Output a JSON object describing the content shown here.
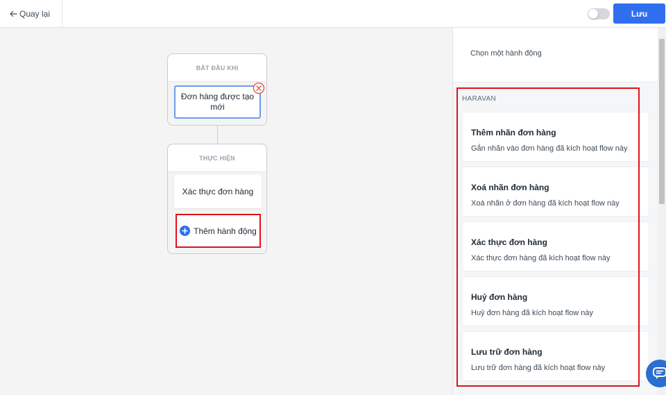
{
  "topbar": {
    "back_label": "Quay lại",
    "save_label": "Lưu",
    "toggle_on": false,
    "accent": "#2f6fef"
  },
  "canvas": {
    "start_card": {
      "title": "BẮT ĐẦU KHI",
      "trigger": "Đơn hàng được tạo mới"
    },
    "do_card": {
      "title": "THỰC HIỆN",
      "action": "Xác thực đơn hàng",
      "add_label": "Thêm hành động"
    }
  },
  "panel": {
    "header": "Chọn một hành động",
    "section": "HARAVAN",
    "options": [
      {
        "title": "Thêm nhãn đơn hàng",
        "desc": "Gắn nhãn vào đơn hàng đã kích hoạt flow này"
      },
      {
        "title": "Xoá nhãn đơn hàng",
        "desc": "Xoá nhãn ở đơn hàng đã kích hoạt flow này"
      },
      {
        "title": "Xác thực đơn hàng",
        "desc": "Xác thực đơn hàng đã kích hoạt flow này"
      },
      {
        "title": "Huỷ đơn hàng",
        "desc": "Huỷ đơn hàng đã kích hoạt flow này"
      },
      {
        "title": "Lưu trữ đơn hàng",
        "desc": "Lưu trữ đơn hàng đã kích hoạt flow này"
      }
    ]
  },
  "colors": {
    "highlight": "#e0101a",
    "trigger_border": "#6d9ce8",
    "chat": "#2a6fcf"
  },
  "icons": [
    "arrow-left-icon",
    "close-circle-icon",
    "plus-circle-icon",
    "chat-icon"
  ]
}
